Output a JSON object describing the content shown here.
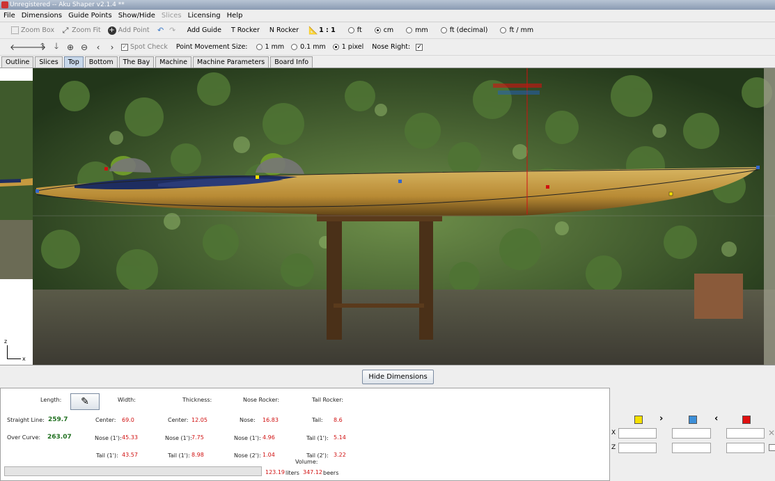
{
  "window": {
    "title": "Unregistered -- Aku Shaper v2.1.4 **"
  },
  "menu": [
    "File",
    "Dimensions",
    "Guide Points",
    "Show/Hide",
    "Slices",
    "Licensing",
    "Help"
  ],
  "menu_disabled": "Slices",
  "toolbar1": {
    "zoom_box": "Zoom Box",
    "zoom_fit": "Zoom Fit",
    "add_point": "Add Point",
    "add_guide": "Add Guide",
    "t_rocker": "T Rocker",
    "n_rocker": "N Rocker",
    "scale": "1 : 1",
    "units": [
      {
        "label": "ft",
        "selected": false
      },
      {
        "label": "cm",
        "selected": true
      },
      {
        "label": "mm",
        "selected": false
      },
      {
        "label": "ft (decimal)",
        "selected": false
      },
      {
        "label": "ft / mm",
        "selected": false
      }
    ]
  },
  "toolbar2": {
    "spot_check": "Spot Check",
    "point_movement_label": "Point Movement Size:",
    "movement_options": [
      {
        "label": "1 mm",
        "selected": false
      },
      {
        "label": "0.1 mm",
        "selected": false
      },
      {
        "label": "1 pixel",
        "selected": true
      }
    ],
    "nose_right_label": "Nose Right:",
    "nose_right_checked": true
  },
  "tabs": [
    "Outline",
    "Slices",
    "Top",
    "Bottom",
    "The Bay",
    "Machine",
    "Machine Parameters",
    "Board Info"
  ],
  "active_tab": "Top",
  "viewport": {
    "axis_z": "z",
    "axis_x": "x"
  },
  "hide_dimensions_label": "Hide Dimensions",
  "dimensions": {
    "headers": {
      "length": "Length:",
      "width": "Width:",
      "thickness": "Thickness:",
      "nose_rocker": "Nose Rocker:",
      "tail_rocker": "Tail Rocker:"
    },
    "length": {
      "straight_line_label": "Straight Line:",
      "straight_line": "259.7",
      "over_curve_label": "Over Curve:",
      "over_curve": "263.07"
    },
    "width": {
      "center_label": "Center:",
      "center": "69.0",
      "nose_label": "Nose (1'):",
      "nose": "45.33",
      "tail_label": "Tail (1'):",
      "tail": "43.57"
    },
    "thickness": {
      "center_label": "Center:",
      "center": "12.05",
      "nose_label": "Nose (1'):",
      "nose": "7.75",
      "tail_label": "Tail (1'):",
      "tail": "8.98"
    },
    "nose_rocker": {
      "nose_label": "Nose:",
      "nose": "16.83",
      "nose1_label": "Nose (1'):",
      "nose1": "4.96",
      "nose2_label": "Nose (2'):",
      "nose2": "1.04"
    },
    "tail_rocker": {
      "tail_label": "Tail:",
      "tail": "8.6",
      "tail1_label": "Tail (1'):",
      "tail1": "5.14",
      "tail2_label": "Tail (2'):",
      "tail2": "3.22"
    },
    "volume": {
      "label": "Volume:",
      "liters": "123.19",
      "liters_unit": "liters",
      "beers": "347.12",
      "beers_unit": "beers"
    }
  },
  "point_panel": {
    "x_label": "X",
    "z_label": "Z"
  },
  "colors": {
    "yellow": "#f5e000",
    "blue": "#3d8fd8",
    "red": "#e01010",
    "accent_tab": "#c8d8ea"
  }
}
